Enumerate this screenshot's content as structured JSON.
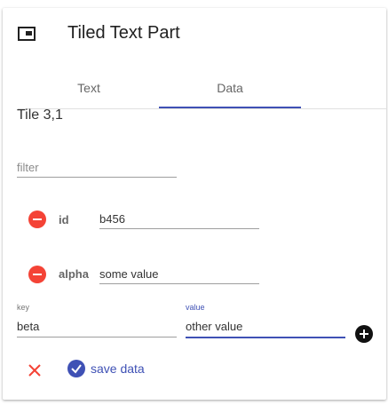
{
  "header": {
    "title": "Tiled Text Part",
    "icon": "picture-in-picture-icon"
  },
  "tabs": [
    {
      "label": "Text",
      "selected": false
    },
    {
      "label": "Data",
      "selected": true
    }
  ],
  "tile_label": "Tile 3,1",
  "filter": {
    "placeholder": "filter",
    "value": ""
  },
  "entries": [
    {
      "key": "id",
      "value": "b456"
    },
    {
      "key": "alpha",
      "value": "some value"
    }
  ],
  "new_entry": {
    "key_label": "key",
    "key_value": "beta",
    "value_label": "value",
    "value_value": "other value"
  },
  "actions": {
    "save_label": "save data"
  },
  "colors": {
    "accent": "#3f51b5",
    "remove": "#f44336",
    "cancel": "#f44336",
    "add": "#111111"
  }
}
